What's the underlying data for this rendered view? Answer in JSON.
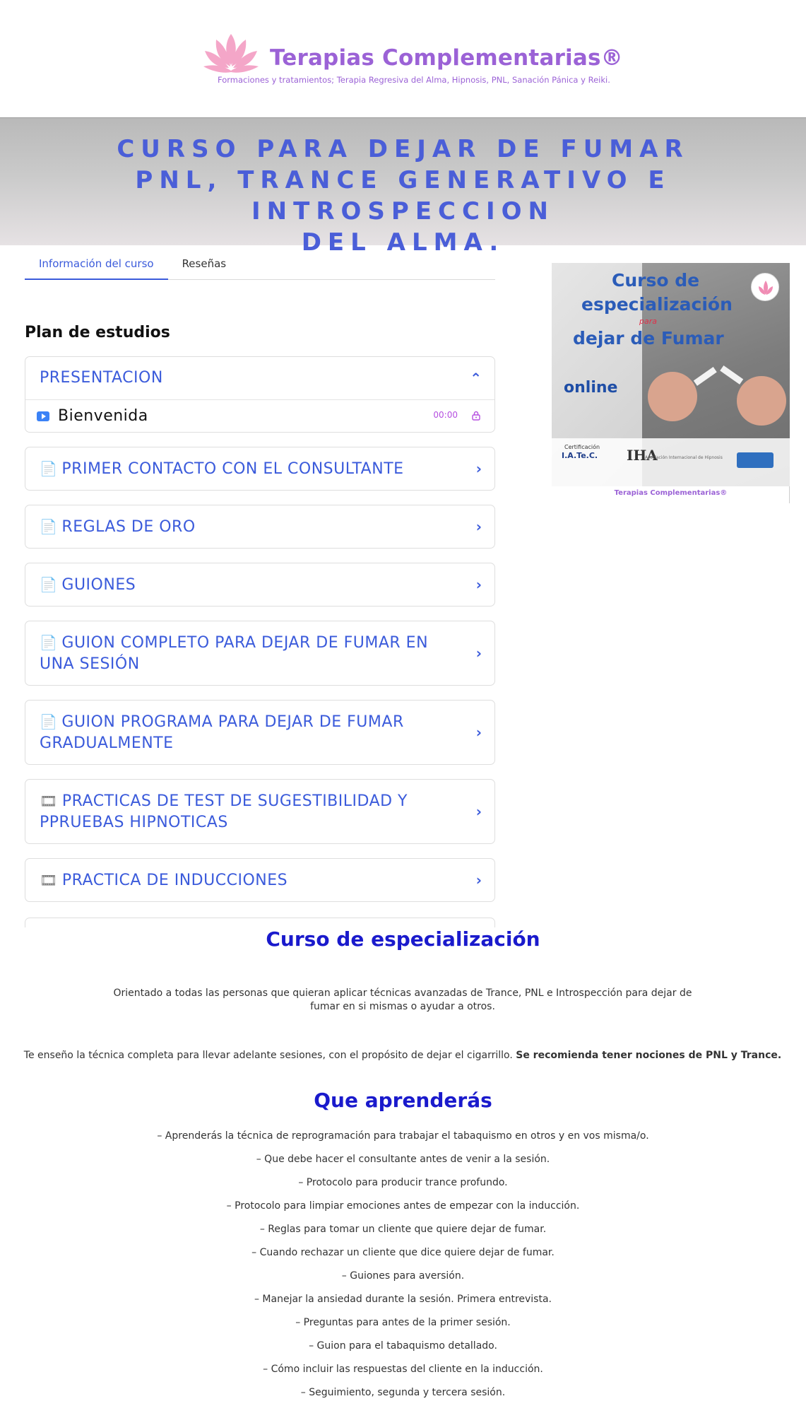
{
  "header": {
    "brand_name": "Terapias Complementarias®",
    "tagline": "Formaciones y tratamientos; Terapia Regresiva del Alma, Hipnosis, PNL, Sanación Pánica y Reiki.",
    "brand_color": "#9b62d6",
    "logo_icon": "lotus-icon"
  },
  "banner": {
    "line1": "CURSO PARA DEJAR DE FUMAR",
    "line2": "PNL, TRANCE GENERATIVO E INTROSPECCION",
    "line3": "DEL ALMA.",
    "title_color": "#4a5ed8"
  },
  "tabs": [
    {
      "label": "Información del curso",
      "active": true
    },
    {
      "label": "Reseñas",
      "active": false
    }
  ],
  "curriculum": {
    "title": "Plan de estudios",
    "accent_color": "#3b5bdb",
    "expanded_module": {
      "title": "PRESENTACION",
      "chevron_icon": "chevron-up-icon",
      "lesson": {
        "title": "Bienvenida",
        "duration": "00:00",
        "type_icon": "video-play-icon",
        "status_icon": "lock-icon"
      }
    },
    "modules": [
      {
        "icon": "📄",
        "icon_name": "document-icon",
        "title": "PRIMER CONTACTO CON EL CONSULTANTE"
      },
      {
        "icon": "📄",
        "icon_name": "document-icon",
        "title": "REGLAS DE ORO"
      },
      {
        "icon": "📄",
        "icon_name": "document-icon",
        "title": "GUIONES"
      },
      {
        "icon": "📄",
        "icon_name": "document-icon",
        "title": "GUION COMPLETO PARA DEJAR DE FUMAR EN UNA SESIÓN"
      },
      {
        "icon": "📄",
        "icon_name": "document-icon",
        "title": "GUION PROGRAMA PARA DEJAR DE FUMAR GRADUALMENTE"
      },
      {
        "icon": "🎞",
        "icon_name": "film-icon",
        "title": "PRACTICAS DE TEST DE SUGESTIBILIDAD Y PPRUEBAS HIPNOTICAS"
      },
      {
        "icon": "🎞",
        "icon_name": "film-icon",
        "title": "PRACTICA DE INDUCCIONES"
      }
    ]
  },
  "course_card": {
    "title_line1": "Curso de",
    "title_line2": "especialización",
    "title_para": "para",
    "title_line3": "dejar de Fumar",
    "online": "online",
    "cert_label": "Certificación",
    "cert_org": "I.A.Te.C.",
    "assoc_logo": "IHA",
    "assoc_text": "Asociación Internacional de Hipnosis",
    "caption": "Terapias Complementarias®"
  },
  "description": {
    "title": "Curso de especialización",
    "paragraph1": "Orientado a todas las personas que quieran aplicar técnicas avanzadas de Trance, PNL e Introspección para dejar de fumar en si mismas o ayudar a otros.",
    "paragraph2_text": "Te enseño la técnica completa para llevar adelante sesiones, con el propósito de dejar el cigarrillo. ",
    "paragraph2_bold": "Se recomienda tener nociones de PNL y Trance."
  },
  "learn": {
    "title": "Que aprenderás",
    "items": [
      "– Aprenderás la técnica de reprogramación para trabajar el tabaquismo en otros y en vos misma/o.",
      "– Que debe hacer el consultante antes de venir a la sesión.",
      "– Protocolo para producir trance profundo.",
      "– Protocolo para limpiar emociones antes de empezar con la inducción.",
      "– Reglas para tomar un cliente que quiere dejar de fumar.",
      "– Cuando rechazar un cliente que dice quiere dejar de fumar.",
      "– Guiones para aversión.",
      "– Manejar la ansiedad durante la sesión. Primera entrevista.",
      "– Preguntas para antes de la primer sesión.",
      "– Guion para el tabaquismo detallado.",
      "– Cómo incluir las respuestas del cliente en la inducción.",
      "– Seguimiento, segunda y tercera sesión."
    ]
  }
}
